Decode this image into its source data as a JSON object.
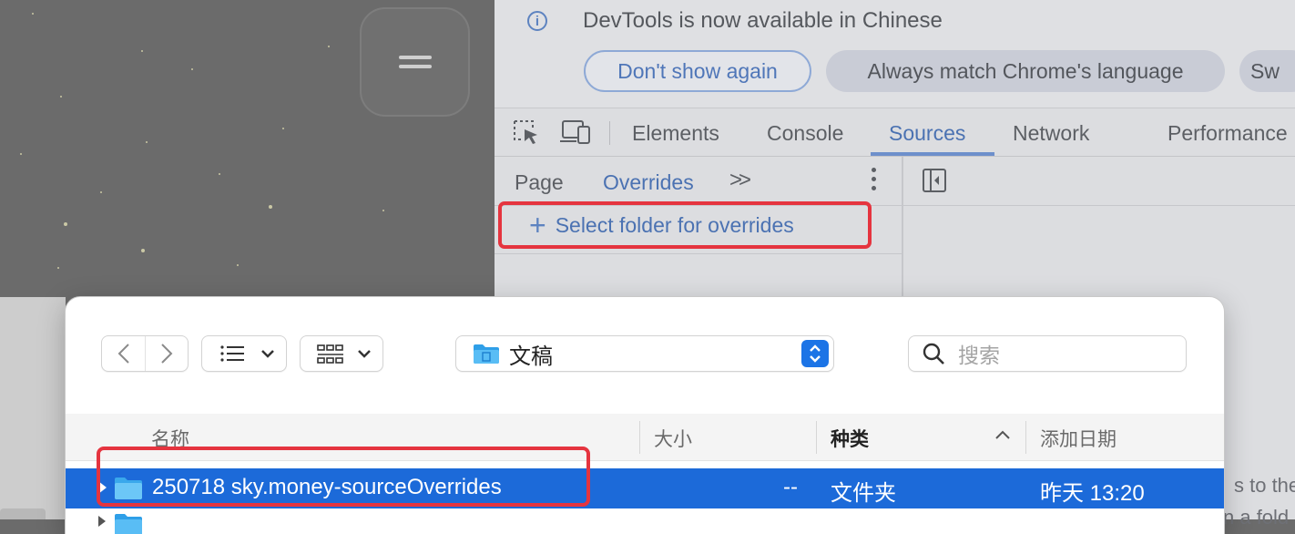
{
  "menu_button": {
    "icon": "hamburger-icon"
  },
  "devtools": {
    "infobar": {
      "message": "DevTools is now available in Chinese",
      "buttons": {
        "dont_show": "Don't show again",
        "always_match": "Always match Chrome's language",
        "switch": "Sw"
      }
    },
    "tabs": {
      "elements": "Elements",
      "console": "Console",
      "sources": "Sources",
      "network": "Network",
      "performance": "Performance"
    },
    "active_tab": "Sources",
    "sources": {
      "subtabs": {
        "page": "Page",
        "overrides": "Overrides",
        "more": ">>"
      },
      "select_folder_label": "Select folder for overrides"
    },
    "background_text": {
      "line1": "s to the",
      "line2": "n a fold"
    }
  },
  "dialog": {
    "path_label": "文稿",
    "search_placeholder": "搜索",
    "columns": {
      "name": "名称",
      "size": "大小",
      "kind": "种类",
      "date": "添加日期"
    },
    "selected_row": {
      "name": "250718 sky.money-sourceOverrides",
      "size": "--",
      "kind": "文件夹",
      "date": "昨天 13:20"
    }
  },
  "colors": {
    "accent_blue": "#1c6ad9",
    "highlight_red": "#e5343f",
    "devtools_link": "#4b72b2"
  }
}
